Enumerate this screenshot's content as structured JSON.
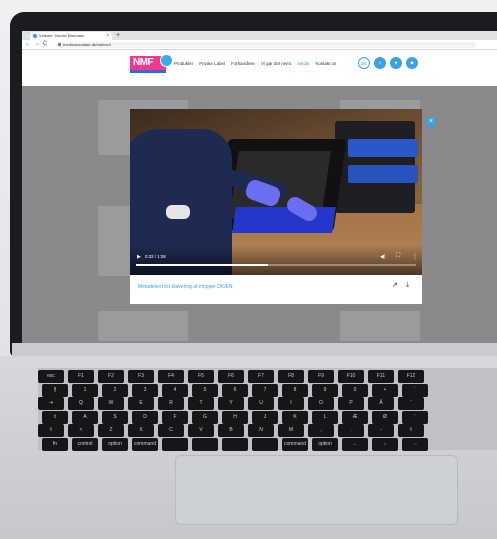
{
  "browser": {
    "tab_title": "Videoer: Nordic Mountain",
    "url": "nordicmountain.dk/videoer/"
  },
  "header": {
    "logo_text": "NMF",
    "menu": [
      "Produkter",
      "Private Label",
      "Forhandlere",
      "Vi gør det nemt",
      "Media",
      "Kontakt os"
    ],
    "active_menu": "Media",
    "lang": "DK"
  },
  "video": {
    "time": "0:32 / 1:08",
    "progress": 0.47
  },
  "modal": {
    "caption": "Metodekort for blavering af mopper DK/EN"
  },
  "colors": {
    "accent": "#3aa3e0",
    "logo_pink": "#ef3a8e"
  },
  "keyboard": {
    "rows": [
      [
        "esc",
        "F1",
        "F2",
        "F3",
        "F4",
        "F5",
        "F6",
        "F7",
        "F8",
        "F9",
        "F10",
        "F11",
        "F12"
      ],
      [
        "§",
        "1",
        "2",
        "3",
        "4",
        "5",
        "6",
        "7",
        "8",
        "9",
        "0",
        "+",
        "´"
      ],
      [
        "⇥",
        "Q",
        "W",
        "E",
        "R",
        "T",
        "Y",
        "U",
        "I",
        "O",
        "P",
        "Å",
        "¨"
      ],
      [
        "⇪",
        "A",
        "S",
        "D",
        "F",
        "G",
        "H",
        "J",
        "K",
        "L",
        "Æ",
        "Ø",
        "'"
      ],
      [
        "⇧",
        "<",
        "Z",
        "X",
        "C",
        "V",
        "B",
        "N",
        "M",
        ",",
        ".",
        "-",
        "⇧"
      ],
      [
        "fn",
        "control",
        "option",
        "command",
        "",
        "",
        "",
        "",
        "command",
        "option",
        "←",
        "↓",
        "→"
      ]
    ]
  }
}
